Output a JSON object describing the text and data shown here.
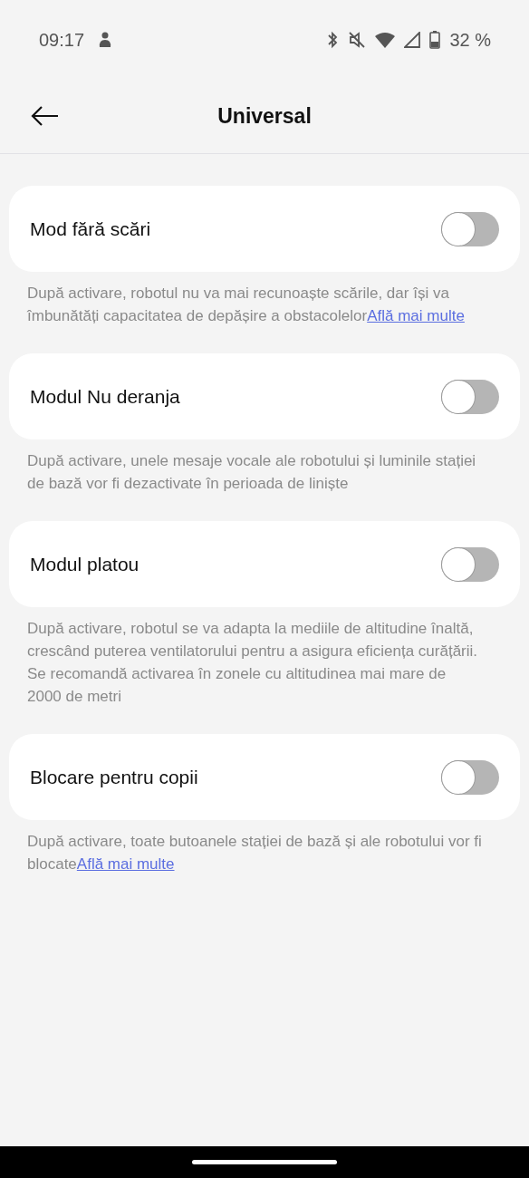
{
  "status_bar": {
    "time": "09:17",
    "battery": "32 %"
  },
  "header": {
    "title": "Universal"
  },
  "settings": [
    {
      "label": "Mod fără scări",
      "on": false,
      "description": "După activare, robotul nu va mai recunoaște scările, dar își va îmbunătăți capacitatea de depășire a obstacolelor",
      "link": "Află mai multe"
    },
    {
      "label": "Modul Nu deranja",
      "on": false,
      "description": "După activare, unele mesaje vocale ale robotului și luminile stației de bază vor fi dezactivate în perioada de liniște"
    },
    {
      "label": "Modul platou",
      "on": false,
      "description": "După activare, robotul se va adapta la mediile de altitudine înaltă, crescând puterea ventilatorului pentru a asigura eficiența curățării. Se recomandă activarea în zonele cu altitudinea mai mare de 2000 de metri"
    },
    {
      "label": "Blocare pentru copii",
      "on": false,
      "description": "După activare, toate butoanele stației de bază și ale robotului vor fi blocate",
      "link": "Află mai multe"
    }
  ]
}
